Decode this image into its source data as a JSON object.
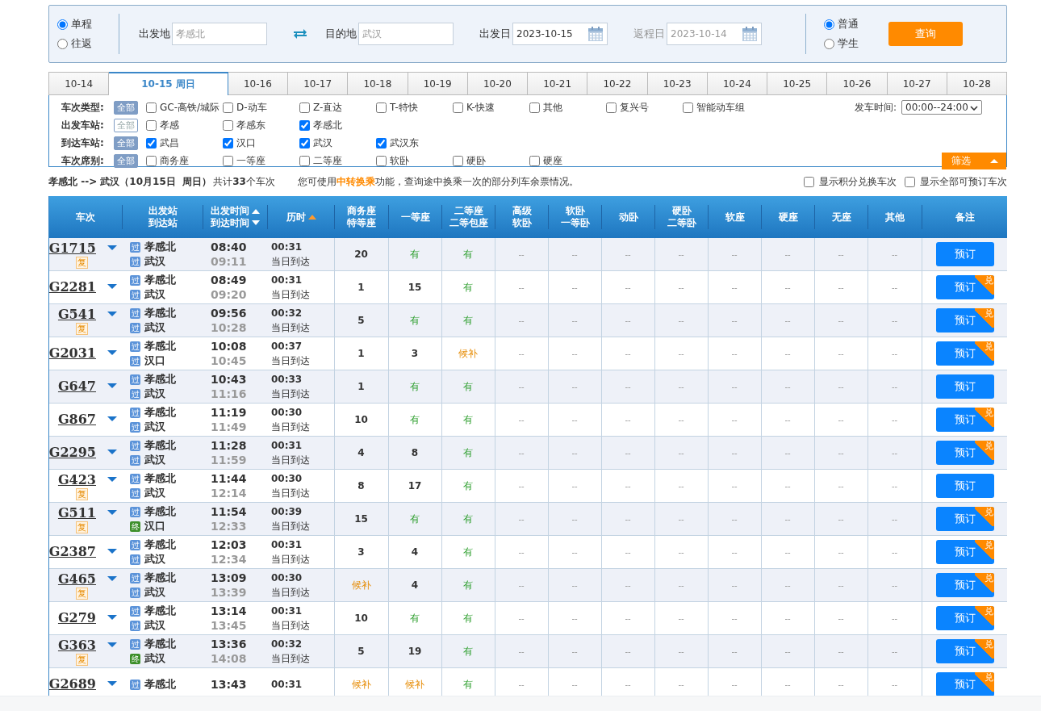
{
  "search": {
    "trip_types": [
      {
        "label": "单程",
        "selected": true
      },
      {
        "label": "往返",
        "selected": false
      }
    ],
    "from": {
      "label": "出发地",
      "value": "孝感北"
    },
    "to": {
      "label": "目的地",
      "value": "武汉"
    },
    "depart_date": {
      "label": "出发日",
      "value": "2023-10-15",
      "disabled": false
    },
    "return_date": {
      "label": "返程日",
      "value": "2023-10-14",
      "disabled": true
    },
    "passenger_types": [
      {
        "label": "普通",
        "selected": true
      },
      {
        "label": "学生",
        "selected": false
      }
    ],
    "query_button": "查询"
  },
  "date_tabs": [
    {
      "label": "10-14",
      "selected": false
    },
    {
      "label": "10-15 周日",
      "selected": true
    },
    {
      "label": "10-16",
      "selected": false
    },
    {
      "label": "10-17",
      "selected": false
    },
    {
      "label": "10-18",
      "selected": false
    },
    {
      "label": "10-19",
      "selected": false
    },
    {
      "label": "10-20",
      "selected": false
    },
    {
      "label": "10-21",
      "selected": false
    },
    {
      "label": "10-22",
      "selected": false
    },
    {
      "label": "10-23",
      "selected": false
    },
    {
      "label": "10-24",
      "selected": false
    },
    {
      "label": "10-25",
      "selected": false
    },
    {
      "label": "10-26",
      "selected": false
    },
    {
      "label": "10-27",
      "selected": false
    },
    {
      "label": "10-28",
      "selected": false
    }
  ],
  "filters": [
    {
      "label": "车次类型:",
      "all": {
        "text": "全部",
        "on": true
      },
      "options": [
        {
          "label": "GC-高铁/城际",
          "checked": false
        },
        {
          "label": "D-动车",
          "checked": false
        },
        {
          "label": "Z-直达",
          "checked": false
        },
        {
          "label": "T-特快",
          "checked": false
        },
        {
          "label": "K-快速",
          "checked": false
        },
        {
          "label": "其他",
          "checked": false
        },
        {
          "label": "复兴号",
          "checked": false
        },
        {
          "label": "智能动车组",
          "checked": false
        }
      ]
    },
    {
      "label": "出发车站:",
      "all": {
        "text": "全部",
        "on": false
      },
      "options": [
        {
          "label": "孝感",
          "checked": false
        },
        {
          "label": "孝感东",
          "checked": false
        },
        {
          "label": "孝感北",
          "checked": true
        }
      ]
    },
    {
      "label": "到达车站:",
      "all": {
        "text": "全部",
        "on": true
      },
      "options": [
        {
          "label": "武昌",
          "checked": true
        },
        {
          "label": "汉口",
          "checked": true
        },
        {
          "label": "武汉",
          "checked": true
        },
        {
          "label": "武汉东",
          "checked": true
        }
      ]
    },
    {
      "label": "车次席别:",
      "all": {
        "text": "全部",
        "on": true
      },
      "options": [
        {
          "label": "商务座",
          "checked": false
        },
        {
          "label": "一等座",
          "checked": false
        },
        {
          "label": "二等座",
          "checked": false
        },
        {
          "label": "软卧",
          "checked": false
        },
        {
          "label": "硬卧",
          "checked": false
        },
        {
          "label": "硬座",
          "checked": false
        }
      ]
    }
  ],
  "departure_time": {
    "label": "发车时间:",
    "value": "00:00--24:00"
  },
  "filter_button": "筛选",
  "summary": {
    "route": "孝感北 --> 武汉（10月15日  周日）",
    "count": "共计**33**个车次",
    "notice_before": "您可使用",
    "notice_link": "中转换乘",
    "notice_after": "功能，查询途中换乘一次的部分列车余票情况。",
    "options": [
      {
        "label": "显示积分兑换车次",
        "checked": false
      },
      {
        "label": "显示全部可预订车次",
        "checked": false
      }
    ]
  },
  "table": {
    "columns": [
      {
        "lines": [
          "车次"
        ]
      },
      {
        "lines": [
          "出发站",
          "到达站"
        ]
      },
      {
        "lines": [
          "出发时间",
          "到达时间"
        ],
        "sort": [
          {
            "kind": "up",
            "active": false
          },
          {
            "kind": "down",
            "active": false
          }
        ]
      },
      {
        "lines": [
          "历时"
        ],
        "sort": [
          {
            "kind": "up",
            "active": true
          }
        ]
      },
      {
        "lines": [
          "商务座",
          "特等座"
        ]
      },
      {
        "lines": [
          "一等座"
        ]
      },
      {
        "lines": [
          "二等座",
          "二等包座"
        ]
      },
      {
        "lines": [
          "高级",
          "软卧"
        ]
      },
      {
        "lines": [
          "软卧",
          "一等卧"
        ]
      },
      {
        "lines": [
          "动卧"
        ]
      },
      {
        "lines": [
          "硬卧",
          "二等卧"
        ]
      },
      {
        "lines": [
          "软座"
        ]
      },
      {
        "lines": [
          "硬座"
        ]
      },
      {
        "lines": [
          "无座"
        ]
      },
      {
        "lines": [
          "其他"
        ]
      },
      {
        "lines": [
          "备注"
        ]
      }
    ],
    "rows": [
      {
        "train": "G1715",
        "fuxing": "复",
        "from": {
          "tag": "过",
          "kind": "pass",
          "name": "孝感北"
        },
        "to": {
          "tag": "过",
          "kind": "pass",
          "name": "武汉"
        },
        "depart": "08:40",
        "arrive": "09:11",
        "duration": "00:31",
        "arrival_note": "当日到达",
        "seats": [
          {
            "text": "20",
            "kind": "count"
          },
          {
            "text": "有",
            "kind": "available"
          },
          {
            "text": "有",
            "kind": "available"
          },
          {
            "text": "--",
            "kind": "none"
          },
          {
            "text": "--",
            "kind": "none"
          },
          {
            "text": "--",
            "kind": "none"
          },
          {
            "text": "--",
            "kind": "none"
          },
          {
            "text": "--",
            "kind": "none"
          },
          {
            "text": "--",
            "kind": "none"
          },
          {
            "text": "--",
            "kind": "none"
          },
          {
            "text": "--",
            "kind": "none"
          }
        ],
        "book": "预订"
      },
      {
        "train": "G2281",
        "from": {
          "tag": "过",
          "kind": "pass",
          "name": "孝感北"
        },
        "to": {
          "tag": "过",
          "kind": "pass",
          "name": "武汉"
        },
        "depart": "08:49",
        "arrive": "09:20",
        "duration": "00:31",
        "arrival_note": "当日到达",
        "seats": [
          {
            "text": "1",
            "kind": "count"
          },
          {
            "text": "15",
            "kind": "count"
          },
          {
            "text": "有",
            "kind": "available"
          },
          {
            "text": "--",
            "kind": "none"
          },
          {
            "text": "--",
            "kind": "none"
          },
          {
            "text": "--",
            "kind": "none"
          },
          {
            "text": "--",
            "kind": "none"
          },
          {
            "text": "--",
            "kind": "none"
          },
          {
            "text": "--",
            "kind": "none"
          },
          {
            "text": "--",
            "kind": "none"
          },
          {
            "text": "--",
            "kind": "none"
          }
        ],
        "book": "预订",
        "exchange": "兑"
      },
      {
        "train": "G541",
        "fuxing": "复",
        "from": {
          "tag": "过",
          "kind": "pass",
          "name": "孝感北"
        },
        "to": {
          "tag": "过",
          "kind": "pass",
          "name": "武汉"
        },
        "depart": "09:56",
        "arrive": "10:28",
        "duration": "00:32",
        "arrival_note": "当日到达",
        "seats": [
          {
            "text": "5",
            "kind": "count"
          },
          {
            "text": "有",
            "kind": "available"
          },
          {
            "text": "有",
            "kind": "available"
          },
          {
            "text": "--",
            "kind": "none"
          },
          {
            "text": "--",
            "kind": "none"
          },
          {
            "text": "--",
            "kind": "none"
          },
          {
            "text": "--",
            "kind": "none"
          },
          {
            "text": "--",
            "kind": "none"
          },
          {
            "text": "--",
            "kind": "none"
          },
          {
            "text": "--",
            "kind": "none"
          },
          {
            "text": "--",
            "kind": "none"
          }
        ],
        "book": "预订",
        "exchange": "兑"
      },
      {
        "train": "G2031",
        "from": {
          "tag": "过",
          "kind": "pass",
          "name": "孝感北"
        },
        "to": {
          "tag": "过",
          "kind": "pass",
          "name": "汉口"
        },
        "depart": "10:08",
        "arrive": "10:45",
        "duration": "00:37",
        "arrival_note": "当日到达",
        "seats": [
          {
            "text": "1",
            "kind": "count"
          },
          {
            "text": "3",
            "kind": "count"
          },
          {
            "text": "候补",
            "kind": "waitlist"
          },
          {
            "text": "--",
            "kind": "none"
          },
          {
            "text": "--",
            "kind": "none"
          },
          {
            "text": "--",
            "kind": "none"
          },
          {
            "text": "--",
            "kind": "none"
          },
          {
            "text": "--",
            "kind": "none"
          },
          {
            "text": "--",
            "kind": "none"
          },
          {
            "text": "--",
            "kind": "none"
          },
          {
            "text": "--",
            "kind": "none"
          }
        ],
        "book": "预订",
        "exchange": "兑"
      },
      {
        "train": "G647",
        "from": {
          "tag": "过",
          "kind": "pass",
          "name": "孝感北"
        },
        "to": {
          "tag": "过",
          "kind": "pass",
          "name": "武汉"
        },
        "depart": "10:43",
        "arrive": "11:16",
        "duration": "00:33",
        "arrival_note": "当日到达",
        "seats": [
          {
            "text": "1",
            "kind": "count"
          },
          {
            "text": "有",
            "kind": "available"
          },
          {
            "text": "有",
            "kind": "available"
          },
          {
            "text": "--",
            "kind": "none"
          },
          {
            "text": "--",
            "kind": "none"
          },
          {
            "text": "--",
            "kind": "none"
          },
          {
            "text": "--",
            "kind": "none"
          },
          {
            "text": "--",
            "kind": "none"
          },
          {
            "text": "--",
            "kind": "none"
          },
          {
            "text": "--",
            "kind": "none"
          },
          {
            "text": "--",
            "kind": "none"
          }
        ],
        "book": "预订"
      },
      {
        "train": "G867",
        "from": {
          "tag": "过",
          "kind": "pass",
          "name": "孝感北"
        },
        "to": {
          "tag": "过",
          "kind": "pass",
          "name": "武汉"
        },
        "depart": "11:19",
        "arrive": "11:49",
        "duration": "00:30",
        "arrival_note": "当日到达",
        "seats": [
          {
            "text": "10",
            "kind": "count"
          },
          {
            "text": "有",
            "kind": "available"
          },
          {
            "text": "有",
            "kind": "available"
          },
          {
            "text": "--",
            "kind": "none"
          },
          {
            "text": "--",
            "kind": "none"
          },
          {
            "text": "--",
            "kind": "none"
          },
          {
            "text": "--",
            "kind": "none"
          },
          {
            "text": "--",
            "kind": "none"
          },
          {
            "text": "--",
            "kind": "none"
          },
          {
            "text": "--",
            "kind": "none"
          },
          {
            "text": "--",
            "kind": "none"
          }
        ],
        "book": "预订",
        "exchange": "兑"
      },
      {
        "train": "G2295",
        "from": {
          "tag": "过",
          "kind": "pass",
          "name": "孝感北"
        },
        "to": {
          "tag": "过",
          "kind": "pass",
          "name": "武汉"
        },
        "depart": "11:28",
        "arrive": "11:59",
        "duration": "00:31",
        "arrival_note": "当日到达",
        "seats": [
          {
            "text": "4",
            "kind": "count"
          },
          {
            "text": "8",
            "kind": "count"
          },
          {
            "text": "有",
            "kind": "available"
          },
          {
            "text": "--",
            "kind": "none"
          },
          {
            "text": "--",
            "kind": "none"
          },
          {
            "text": "--",
            "kind": "none"
          },
          {
            "text": "--",
            "kind": "none"
          },
          {
            "text": "--",
            "kind": "none"
          },
          {
            "text": "--",
            "kind": "none"
          },
          {
            "text": "--",
            "kind": "none"
          },
          {
            "text": "--",
            "kind": "none"
          }
        ],
        "book": "预订",
        "exchange": "兑"
      },
      {
        "train": "G423",
        "fuxing": "复",
        "from": {
          "tag": "过",
          "kind": "pass",
          "name": "孝感北"
        },
        "to": {
          "tag": "过",
          "kind": "pass",
          "name": "武汉"
        },
        "depart": "11:44",
        "arrive": "12:14",
        "duration": "00:30",
        "arrival_note": "当日到达",
        "seats": [
          {
            "text": "8",
            "kind": "count"
          },
          {
            "text": "17",
            "kind": "count"
          },
          {
            "text": "有",
            "kind": "available"
          },
          {
            "text": "--",
            "kind": "none"
          },
          {
            "text": "--",
            "kind": "none"
          },
          {
            "text": "--",
            "kind": "none"
          },
          {
            "text": "--",
            "kind": "none"
          },
          {
            "text": "--",
            "kind": "none"
          },
          {
            "text": "--",
            "kind": "none"
          },
          {
            "text": "--",
            "kind": "none"
          },
          {
            "text": "--",
            "kind": "none"
          }
        ],
        "book": "预订"
      },
      {
        "train": "G511",
        "fuxing": "复",
        "from": {
          "tag": "过",
          "kind": "pass",
          "name": "孝感北"
        },
        "to": {
          "tag": "终",
          "kind": "end",
          "name": "汉口"
        },
        "depart": "11:54",
        "arrive": "12:33",
        "duration": "00:39",
        "arrival_note": "当日到达",
        "seats": [
          {
            "text": "15",
            "kind": "count"
          },
          {
            "text": "有",
            "kind": "available"
          },
          {
            "text": "有",
            "kind": "available"
          },
          {
            "text": "--",
            "kind": "none"
          },
          {
            "text": "--",
            "kind": "none"
          },
          {
            "text": "--",
            "kind": "none"
          },
          {
            "text": "--",
            "kind": "none"
          },
          {
            "text": "--",
            "kind": "none"
          },
          {
            "text": "--",
            "kind": "none"
          },
          {
            "text": "--",
            "kind": "none"
          },
          {
            "text": "--",
            "kind": "none"
          }
        ],
        "book": "预订",
        "exchange": "兑"
      },
      {
        "train": "G2387",
        "from": {
          "tag": "过",
          "kind": "pass",
          "name": "孝感北"
        },
        "to": {
          "tag": "过",
          "kind": "pass",
          "name": "武汉"
        },
        "depart": "12:03",
        "arrive": "12:34",
        "duration": "00:31",
        "arrival_note": "当日到达",
        "seats": [
          {
            "text": "3",
            "kind": "count"
          },
          {
            "text": "4",
            "kind": "count"
          },
          {
            "text": "有",
            "kind": "available"
          },
          {
            "text": "--",
            "kind": "none"
          },
          {
            "text": "--",
            "kind": "none"
          },
          {
            "text": "--",
            "kind": "none"
          },
          {
            "text": "--",
            "kind": "none"
          },
          {
            "text": "--",
            "kind": "none"
          },
          {
            "text": "--",
            "kind": "none"
          },
          {
            "text": "--",
            "kind": "none"
          },
          {
            "text": "--",
            "kind": "none"
          }
        ],
        "book": "预订",
        "exchange": "兑"
      },
      {
        "train": "G465",
        "fuxing": "复",
        "from": {
          "tag": "过",
          "kind": "pass",
          "name": "孝感北"
        },
        "to": {
          "tag": "过",
          "kind": "pass",
          "name": "武汉"
        },
        "depart": "13:09",
        "arrive": "13:39",
        "duration": "00:30",
        "arrival_note": "当日到达",
        "seats": [
          {
            "text": "候补",
            "kind": "waitlist"
          },
          {
            "text": "4",
            "kind": "count"
          },
          {
            "text": "有",
            "kind": "available"
          },
          {
            "text": "--",
            "kind": "none"
          },
          {
            "text": "--",
            "kind": "none"
          },
          {
            "text": "--",
            "kind": "none"
          },
          {
            "text": "--",
            "kind": "none"
          },
          {
            "text": "--",
            "kind": "none"
          },
          {
            "text": "--",
            "kind": "none"
          },
          {
            "text": "--",
            "kind": "none"
          },
          {
            "text": "--",
            "kind": "none"
          }
        ],
        "book": "预订",
        "exchange": "兑"
      },
      {
        "train": "G279",
        "from": {
          "tag": "过",
          "kind": "pass",
          "name": "孝感北"
        },
        "to": {
          "tag": "过",
          "kind": "pass",
          "name": "武汉"
        },
        "depart": "13:14",
        "arrive": "13:45",
        "duration": "00:31",
        "arrival_note": "当日到达",
        "seats": [
          {
            "text": "10",
            "kind": "count"
          },
          {
            "text": "有",
            "kind": "available"
          },
          {
            "text": "有",
            "kind": "available"
          },
          {
            "text": "--",
            "kind": "none"
          },
          {
            "text": "--",
            "kind": "none"
          },
          {
            "text": "--",
            "kind": "none"
          },
          {
            "text": "--",
            "kind": "none"
          },
          {
            "text": "--",
            "kind": "none"
          },
          {
            "text": "--",
            "kind": "none"
          },
          {
            "text": "--",
            "kind": "none"
          },
          {
            "text": "--",
            "kind": "none"
          }
        ],
        "book": "预订",
        "exchange": "兑"
      },
      {
        "train": "G363",
        "fuxing": "复",
        "from": {
          "tag": "过",
          "kind": "pass",
          "name": "孝感北"
        },
        "to": {
          "tag": "终",
          "kind": "end",
          "name": "武汉"
        },
        "depart": "13:36",
        "arrive": "14:08",
        "duration": "00:32",
        "arrival_note": "当日到达",
        "seats": [
          {
            "text": "5",
            "kind": "count"
          },
          {
            "text": "19",
            "kind": "count"
          },
          {
            "text": "有",
            "kind": "available"
          },
          {
            "text": "--",
            "kind": "none"
          },
          {
            "text": "--",
            "kind": "none"
          },
          {
            "text": "--",
            "kind": "none"
          },
          {
            "text": "--",
            "kind": "none"
          },
          {
            "text": "--",
            "kind": "none"
          },
          {
            "text": "--",
            "kind": "none"
          },
          {
            "text": "--",
            "kind": "none"
          },
          {
            "text": "--",
            "kind": "none"
          }
        ],
        "book": "预订",
        "exchange": "兑"
      },
      {
        "train": "G2689",
        "from": {
          "tag": "过",
          "kind": "pass",
          "name": "孝感北"
        },
        "depart": "13:43",
        "duration": "00:31",
        "seats": [
          {
            "text": "候补",
            "kind": "waitlist"
          },
          {
            "text": "候补",
            "kind": "waitlist"
          },
          {
            "text": "有",
            "kind": "available"
          },
          {
            "text": "--",
            "kind": "none"
          },
          {
            "text": "--",
            "kind": "none"
          },
          {
            "text": "--",
            "kind": "none"
          },
          {
            "text": "--",
            "kind": "none"
          },
          {
            "text": "--",
            "kind": "none"
          },
          {
            "text": "--",
            "kind": "none"
          },
          {
            "text": "--",
            "kind": "none"
          },
          {
            "text": "--",
            "kind": "none"
          }
        ],
        "book": "预订",
        "exchange": "兑"
      }
    ]
  }
}
